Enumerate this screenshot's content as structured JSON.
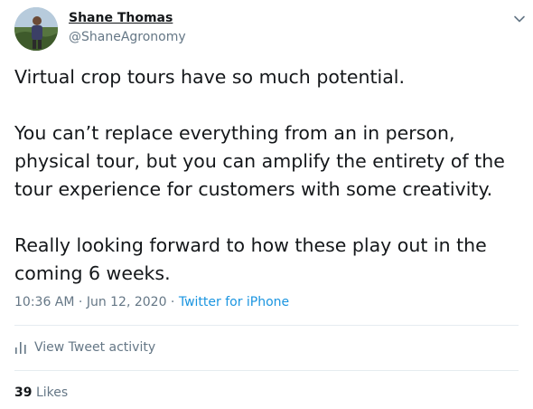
{
  "user": {
    "name": "Shane Thomas",
    "handle": "@ShaneAgronomy"
  },
  "tweet": {
    "paragraphs": [
      "Virtual crop tours have so much potential.",
      "You can’t replace everything from an in person, physical tour, but you can amplify the entirety of the tour experience for customers with some creativity.",
      "Really looking forward to how these play out in the coming 6 weeks."
    ]
  },
  "meta": {
    "time": "10:36 AM",
    "separator1": " · ",
    "date": "Jun 12, 2020",
    "separator2": " · ",
    "source": "Twitter for iPhone"
  },
  "activity": {
    "icon": "bar-chart-icon",
    "label": "View Tweet activity"
  },
  "likes": {
    "count": "39",
    "label": "Likes"
  },
  "colors": {
    "text": "#14171a",
    "secondary": "#657786",
    "link": "#1b95e0",
    "border": "#e6ecf0"
  }
}
